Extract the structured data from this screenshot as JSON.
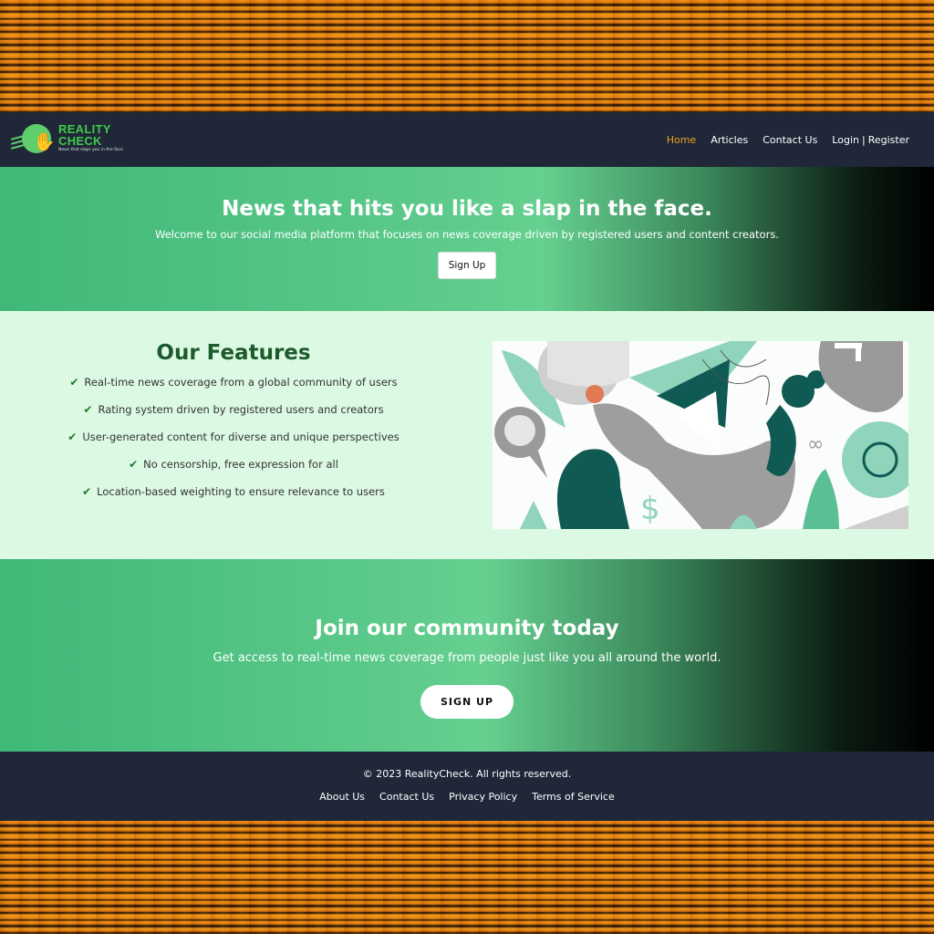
{
  "brand": {
    "title_line1": "REALITY",
    "title_line2": "CHECK",
    "tagline": "News that slaps you in the face"
  },
  "nav": {
    "home": "Home",
    "articles": "Articles",
    "contact": "Contact Us",
    "login": "Login",
    "separator": "|",
    "register": "Register"
  },
  "hero": {
    "title": "News that hits you like a slap in the face.",
    "subtitle": "Welcome to our social media platform that focuses on news coverage driven by registered users and content creators.",
    "button": "Sign Up"
  },
  "features": {
    "title": "Our Features",
    "items": [
      "Real-time news coverage from a global community of users",
      "Rating system driven by registered users and creators",
      "User-generated content for diverse and unique perspectives",
      "No censorship, free expression for all",
      "Location-based weighting to ensure relevance to users"
    ]
  },
  "community": {
    "title": "Join our community today",
    "subtitle": "Get access to real-time news coverage from people just like you all around the world.",
    "button": "SIGN UP"
  },
  "footer": {
    "copyright": "© 2023 RealityCheck. All rights reserved.",
    "links": [
      "About Us",
      "Contact Us",
      "Privacy Policy",
      "Terms of Service"
    ]
  },
  "colors": {
    "nav_bg": "#1f2738",
    "accent_green": "#3ecb4a",
    "active_link": "#f0a020",
    "features_bg": "#dcf9e3",
    "heading_green": "#1d5a2c"
  }
}
